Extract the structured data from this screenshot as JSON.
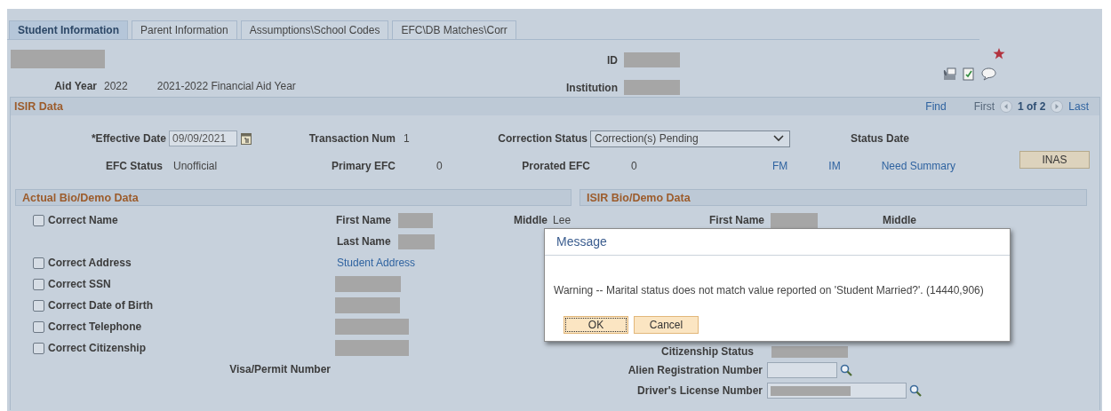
{
  "tabs": [
    {
      "label": "Student Information",
      "selected": true
    },
    {
      "label": "Parent Information",
      "selected": false
    },
    {
      "label": "Assumptions\\School Codes",
      "selected": false
    },
    {
      "label": "EFC\\DB Matches\\Corr",
      "selected": false
    }
  ],
  "header": {
    "id_label": "ID",
    "institution_label": "Institution",
    "aid_year_label": "Aid Year",
    "aid_year": "2022",
    "aid_year_desc": "2021-2022 Financial Aid Year"
  },
  "isir": {
    "title": "ISIR Data",
    "find": "Find",
    "first": "First",
    "page": "1 of 2",
    "last": "Last",
    "effective_date_label": "*Effective Date",
    "effective_date": "09/09/2021",
    "transaction_label": "Transaction Num",
    "transaction": "1",
    "correction_status_label": "Correction Status",
    "correction_status": "Correction(s) Pending",
    "status_date_label": "Status Date",
    "efc_status_label": "EFC Status",
    "efc_status": "Unofficial",
    "primary_efc_label": "Primary EFC",
    "primary_efc": "0",
    "prorated_efc_label": "Prorated EFC",
    "prorated_efc": "0",
    "links": [
      "FM",
      "IM",
      "Need Summary"
    ],
    "inas_button": "INAS"
  },
  "actual": {
    "title": "Actual Bio/Demo Data",
    "first_name_label": "First Name",
    "last_name_label": "Last Name",
    "middle_label": "Middle",
    "middle": "Lee",
    "student_address": "Student Address",
    "visa_label": "Visa/Permit Number",
    "corrections": [
      {
        "label": "Correct Name",
        "checked": false
      },
      {
        "label": "Correct Address",
        "checked": false
      },
      {
        "label": "Correct SSN",
        "checked": false
      },
      {
        "label": "Correct Date of Birth",
        "checked": false
      },
      {
        "label": "Correct Telephone",
        "checked": false
      },
      {
        "label": "Correct Citizenship",
        "checked": false
      }
    ]
  },
  "isir_bio": {
    "title": "ISIR Bio/Demo Data",
    "first_name_label": "First Name",
    "middle_label": "Middle",
    "citizenship_status_label": "Citizenship Status",
    "alien_label": "Alien Registration Number",
    "drivers_license_label": "Driver's License Number"
  },
  "dialog": {
    "title": "Message",
    "text": "Warning -- Marital status does not match value reported on 'Student Married?'. (14440,906)",
    "buttons": [
      "OK",
      "Cancel"
    ]
  }
}
